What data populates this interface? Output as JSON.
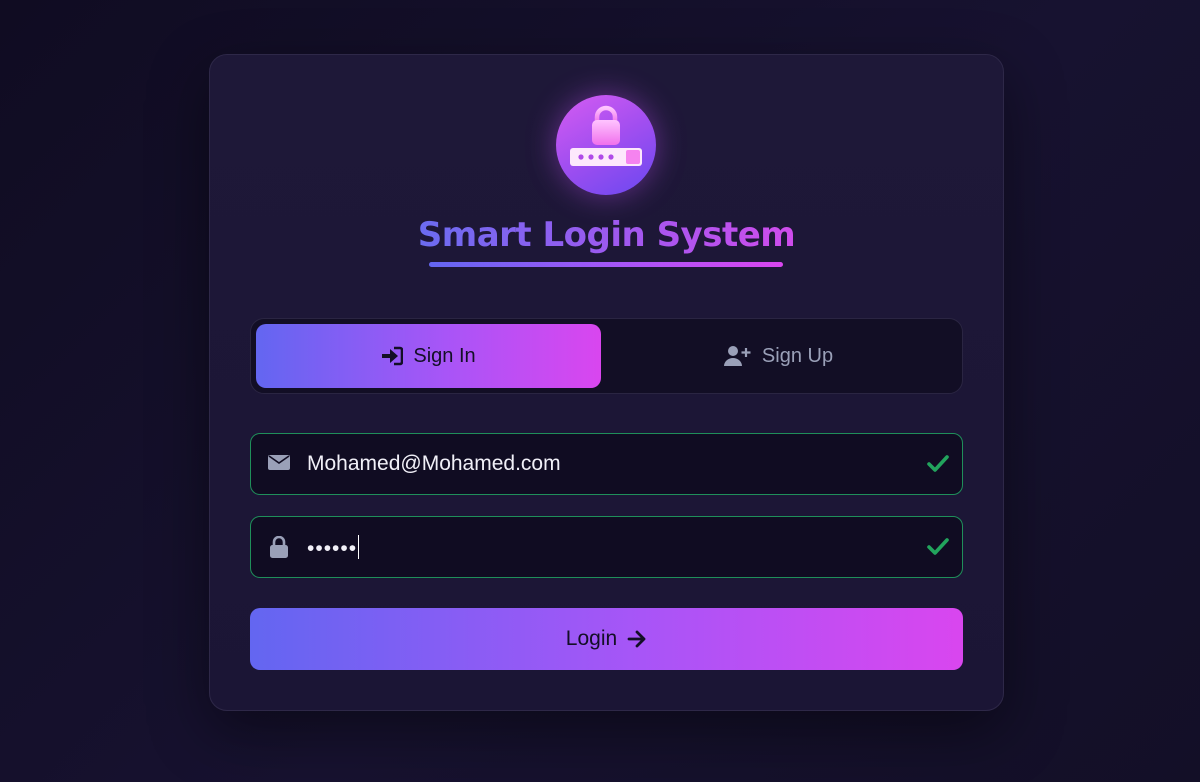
{
  "app": {
    "title": "Smart Login System"
  },
  "tabs": [
    {
      "label": "Sign In",
      "icon": "sign-in-icon",
      "active": true
    },
    {
      "label": "Sign Up",
      "icon": "user-plus-icon",
      "active": false
    }
  ],
  "form": {
    "email": {
      "value": "Mohamed@Mohamed.com",
      "icon": "envelope-icon",
      "valid": true
    },
    "password": {
      "value": "••••••",
      "icon": "lock-icon",
      "valid": true
    },
    "submit_label": "Login",
    "submit_icon": "arrow-right-icon"
  },
  "colors": {
    "accent_start": "#6366f1",
    "accent_end": "#d946ef",
    "valid": "#22a45d",
    "background": "#120e25"
  }
}
